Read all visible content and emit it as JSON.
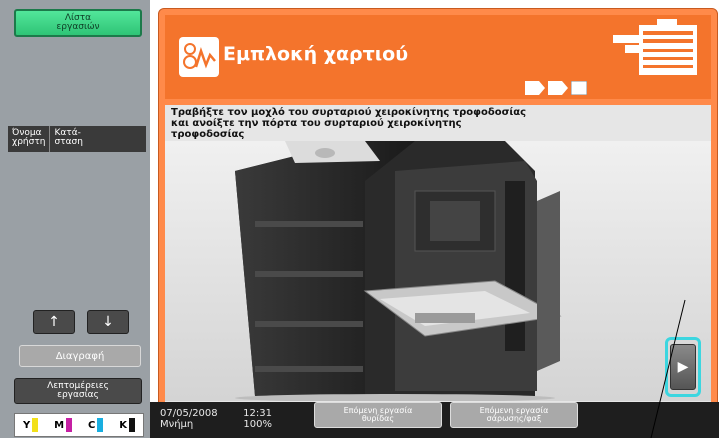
{
  "sidebar": {
    "job_list_label_1": "Λίστα",
    "job_list_label_2": "εργασιών",
    "columns": {
      "user_name_1": "Όνομα",
      "user_name_2": "χρήστη",
      "status_1": "Κατά-",
      "status_2": "σταση"
    },
    "up_arrow": "↑",
    "down_arrow": "↓",
    "delete_label": "Διαγραφή",
    "details_label_1": "Λεπτομέρειες",
    "details_label_2": "εργασίας",
    "toner": [
      {
        "letter": "Y",
        "color": "#f2e01a"
      },
      {
        "letter": "M",
        "color": "#c51fa3"
      },
      {
        "letter": "C",
        "color": "#18aee0"
      },
      {
        "letter": "K",
        "color": "#111111"
      }
    ]
  },
  "main": {
    "title": "Εμπλοκή χαρτιού",
    "instruction": "Τραβήξτε τον μοχλό του συρταριού χειροκίνητης τροφοδοσίας και ανοίξτε την πόρτα του συρταριού χειροκίνητης τροφοδοσίας",
    "next_symbol": "▶"
  },
  "bottom": {
    "date": "07/05/2008",
    "time": "12:31",
    "memory_label": "Μνήμη",
    "memory_value": "100%",
    "next_job_1_line1": "Επόμενη εργασία",
    "next_job_1_line2": "θυρίδας",
    "next_job_2_line1": "Επόμενη εργασία",
    "next_job_2_line2": "σάρωσης/φαξ"
  },
  "colors": {
    "accent": "#ff8a4a",
    "header": "#f4742c",
    "highlight": "#3cd6e0",
    "job_list_green": "#2fc476"
  }
}
